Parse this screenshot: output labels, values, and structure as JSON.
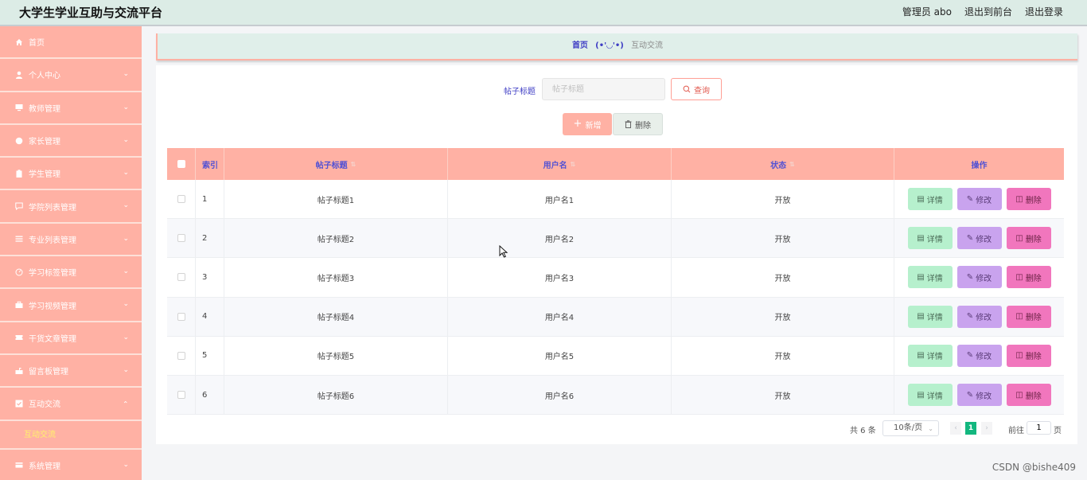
{
  "header": {
    "title": "大学生学业互助与交流平台",
    "admin": "管理员 abo",
    "exit_front": "退出到前台",
    "logout": "退出登录"
  },
  "sidebar": {
    "items": [
      {
        "label": "首页",
        "icon": "home-icon"
      },
      {
        "label": "个人中心",
        "icon": "user-icon"
      },
      {
        "label": "教师管理",
        "icon": "monitor-icon"
      },
      {
        "label": "家长管理",
        "icon": "globe-icon"
      },
      {
        "label": "学生管理",
        "icon": "clipboard-icon"
      },
      {
        "label": "学院列表管理",
        "icon": "chat-icon"
      },
      {
        "label": "专业列表管理",
        "icon": "list-icon"
      },
      {
        "label": "学习标签管理",
        "icon": "gauge-icon"
      },
      {
        "label": "学习视频管理",
        "icon": "briefcase-icon"
      },
      {
        "label": "干货文章管理",
        "icon": "ticket-icon"
      },
      {
        "label": "留言板管理",
        "icon": "mailbox-icon"
      },
      {
        "label": "互动交流",
        "icon": "check-icon"
      },
      {
        "label": "系统管理",
        "icon": "card-icon"
      }
    ],
    "sub_item": "互动交流"
  },
  "breadcrumb": {
    "home": "首页",
    "face": "(•'◡'•)",
    "current": "互动交流"
  },
  "search": {
    "label": "帖子标题",
    "placeholder": "帖子标题",
    "query_label": "查询"
  },
  "actions": {
    "add_label": "新增",
    "delete_label": "删除"
  },
  "table": {
    "headers": [
      "索引",
      "帖子标题",
      "用户名",
      "状态",
      "操作"
    ],
    "rows": [
      {
        "index": "1",
        "title": "帖子标题1",
        "user": "用户名1",
        "status": "开放"
      },
      {
        "index": "2",
        "title": "帖子标题2",
        "user": "用户名2",
        "status": "开放"
      },
      {
        "index": "3",
        "title": "帖子标题3",
        "user": "用户名3",
        "status": "开放"
      },
      {
        "index": "4",
        "title": "帖子标题4",
        "user": "用户名4",
        "status": "开放"
      },
      {
        "index": "5",
        "title": "帖子标题5",
        "user": "用户名5",
        "status": "开放"
      },
      {
        "index": "6",
        "title": "帖子标题6",
        "user": "用户名6",
        "status": "开放"
      }
    ],
    "op_detail": "详情",
    "op_edit": "修改",
    "op_delete": "删除"
  },
  "pagination": {
    "total": "共 6 条",
    "page_size": "10条/页",
    "current": "1",
    "goto_prefix": "前往",
    "goto_value": "1",
    "goto_suffix": "页"
  },
  "watermark": "CSDN @bishe409",
  "colors": {
    "accent": "#ffb1a4",
    "header_bg": "#dcece6",
    "link": "#3e3dc4",
    "pager_active": "#13b77f"
  }
}
